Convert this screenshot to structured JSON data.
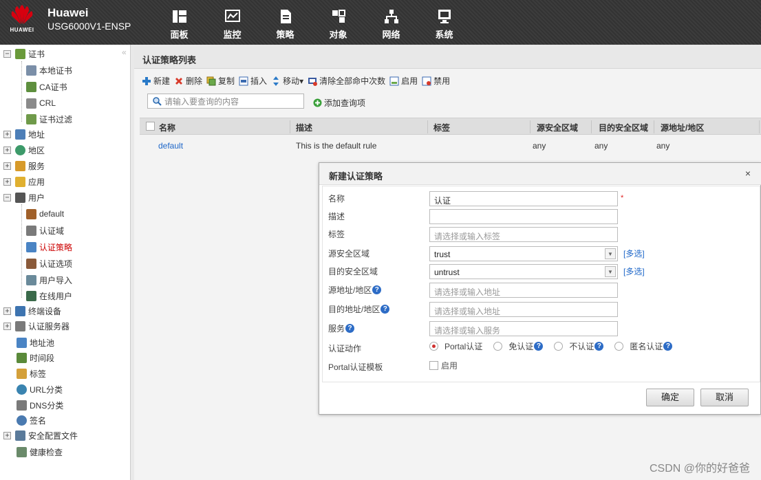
{
  "header": {
    "brand": "HUAWEI",
    "product_name": "Huawei",
    "product_model": "USG6000V1-ENSP",
    "nav": [
      {
        "label": "面板",
        "icon": "dashboard-icon"
      },
      {
        "label": "监控",
        "icon": "monitor-icon"
      },
      {
        "label": "策略",
        "icon": "policy-icon"
      },
      {
        "label": "对象",
        "icon": "object-icon"
      },
      {
        "label": "网络",
        "icon": "network-icon"
      },
      {
        "label": "系统",
        "icon": "system-icon"
      }
    ]
  },
  "sidebar": {
    "items": [
      {
        "label": "证书",
        "expanded": true
      },
      {
        "label": "本地证书"
      },
      {
        "label": "CA证书"
      },
      {
        "label": "CRL"
      },
      {
        "label": "证书过滤"
      },
      {
        "label": "地址",
        "expanded": false
      },
      {
        "label": "地区",
        "expanded": false
      },
      {
        "label": "服务",
        "expanded": false
      },
      {
        "label": "应用",
        "expanded": false
      },
      {
        "label": "用户",
        "expanded": true
      },
      {
        "label": "default"
      },
      {
        "label": "认证域"
      },
      {
        "label": "认证策略",
        "active": true
      },
      {
        "label": "认证选项"
      },
      {
        "label": "用户导入"
      },
      {
        "label": "在线用户"
      },
      {
        "label": "终端设备",
        "expanded": false
      },
      {
        "label": "认证服务器",
        "expanded": false
      },
      {
        "label": "地址池"
      },
      {
        "label": "时间段"
      },
      {
        "label": "标签"
      },
      {
        "label": "URL分类"
      },
      {
        "label": "DNS分类"
      },
      {
        "label": "签名"
      },
      {
        "label": "安全配置文件",
        "expanded": false
      },
      {
        "label": "健康检查"
      }
    ]
  },
  "main": {
    "title": "认证策略列表",
    "toolbar": {
      "new": "新建",
      "delete": "删除",
      "copy": "复制",
      "insert": "插入",
      "move": "移动▾",
      "clear_hits": "清除全部命中次数",
      "enable": "启用",
      "disable": "禁用"
    },
    "search_placeholder": "请输入要查询的内容",
    "add_query": "添加查询项",
    "columns": [
      "名称",
      "描述",
      "标签",
      "源安全区域",
      "目的安全区域",
      "源地址/地区"
    ],
    "rows": [
      {
        "name": "default",
        "description": "This is the default rule",
        "tag": "",
        "src_zone": "any",
        "dst_zone": "any",
        "src_addr": "any"
      }
    ]
  },
  "dialog": {
    "title": "新建认证策略",
    "close": "×",
    "fields": {
      "name_label": "名称",
      "name_value": "认证",
      "required_mark": "*",
      "desc_label": "描述",
      "desc_value": "",
      "tag_label": "标签",
      "tag_placeholder": "请选择或输入标签",
      "src_zone_label": "源安全区域",
      "src_zone_value": "trust",
      "dst_zone_label": "目的安全区域",
      "dst_zone_value": "untrust",
      "multi_select": "[多选]",
      "src_addr_label": "源地址/地区",
      "src_addr_placeholder": "请选择或输入地址",
      "dst_addr_label": "目的地址/地区",
      "dst_addr_placeholder": "请选择或输入地址",
      "service_label": "服务",
      "service_placeholder": "请选择或输入服务",
      "action_label": "认证动作",
      "action_options": [
        {
          "label": "Portal认证",
          "selected": true,
          "help": false
        },
        {
          "label": "免认证",
          "selected": false,
          "help": true
        },
        {
          "label": "不认证",
          "selected": false,
          "help": true
        },
        {
          "label": "匿名认证",
          "selected": false,
          "help": true
        }
      ],
      "portal_template_label": "Portal认证模板",
      "portal_template_checkbox": "启用",
      "help_glyph": "?"
    },
    "ok": "确定",
    "cancel": "取消"
  },
  "watermark": "CSDN @你的好爸爸",
  "colors": {
    "topbar": "#353535",
    "link": "#1d66c8",
    "active_tree": "#cc0000",
    "radio_selected": "#d0302e",
    "help_badge": "#2d6cc6",
    "huawei_red": "#d7000f"
  }
}
